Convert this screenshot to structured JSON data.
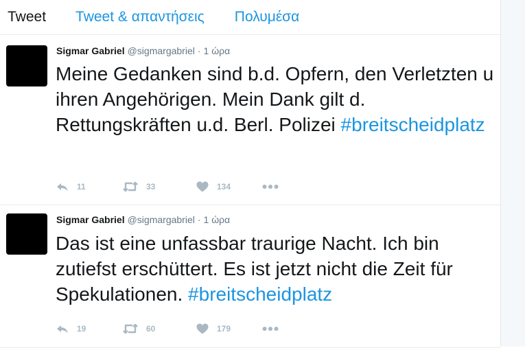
{
  "tabs": [
    "Tweet",
    "Tweet & απαντήσεις",
    "Πολυμέσα"
  ],
  "tweets": [
    {
      "name": "Sigmar Gabriel",
      "handle": "@sigmargabriel",
      "separator": "·",
      "time": "1 ώρα",
      "text": "Meine Gedanken sind b.d. Opfern, den Verletzten u ihren Angehörigen. Mein Dank gilt d. Rettungskräften u.d. Berl. Polizei",
      "hashtag": "#breitscheidplatz",
      "replies": "11",
      "retweets": "33",
      "likes": "134"
    },
    {
      "name": "Sigmar Gabriel",
      "handle": "@sigmargabriel",
      "separator": "·",
      "time": "1 ώρα",
      "text": "Das ist eine unfassbar traurige Nacht. Ich bin zutiefst erschüttert. Es ist jetzt nicht die Zeit für Spekulationen.",
      "hashtag": "#breitscheidplatz",
      "replies": "19",
      "retweets": "60",
      "likes": "179"
    }
  ],
  "icons": {
    "reply": "reply-icon",
    "retweet": "retweet-icon",
    "like": "heart-icon",
    "more": "more-icon"
  },
  "colors": {
    "link": "#1b95e0",
    "text": "#14171a",
    "secondary": "#657786",
    "icon": "#aab8c2",
    "border": "#e6ecf0"
  }
}
